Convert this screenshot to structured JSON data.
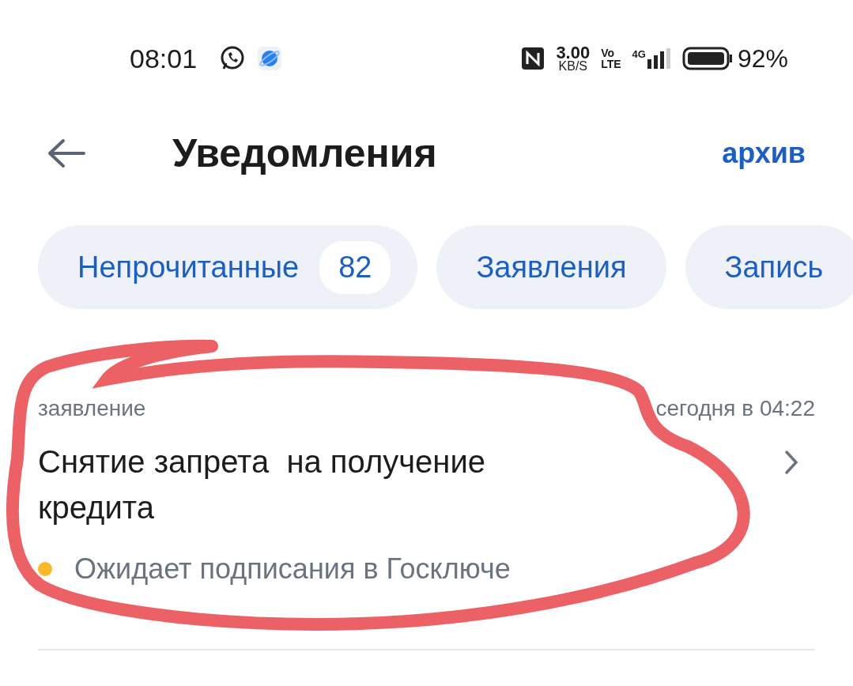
{
  "status_bar": {
    "time": "08:01",
    "speed_value": "3.00",
    "speed_unit": "KB/S",
    "volte_top": "Vo",
    "volte_bottom": "LTE",
    "network": "4G",
    "battery": "92%"
  },
  "header": {
    "title": "Уведомления",
    "action": "архив"
  },
  "filters": [
    {
      "label": "Непрочитанные",
      "count": "82",
      "selected": false
    },
    {
      "label": "Заявления",
      "selected": false
    },
    {
      "label": "Запись",
      "selected": false
    }
  ],
  "notifications": [
    {
      "category": "заявление",
      "time": "сегодня в 04:22",
      "title": "Снятие запрета  на получение кредита",
      "status": "Ожидает подписания в Госключе",
      "color": "#fbb82a"
    }
  ],
  "annotation": {
    "kind": "freehand-circle",
    "color": "#ec6165"
  }
}
